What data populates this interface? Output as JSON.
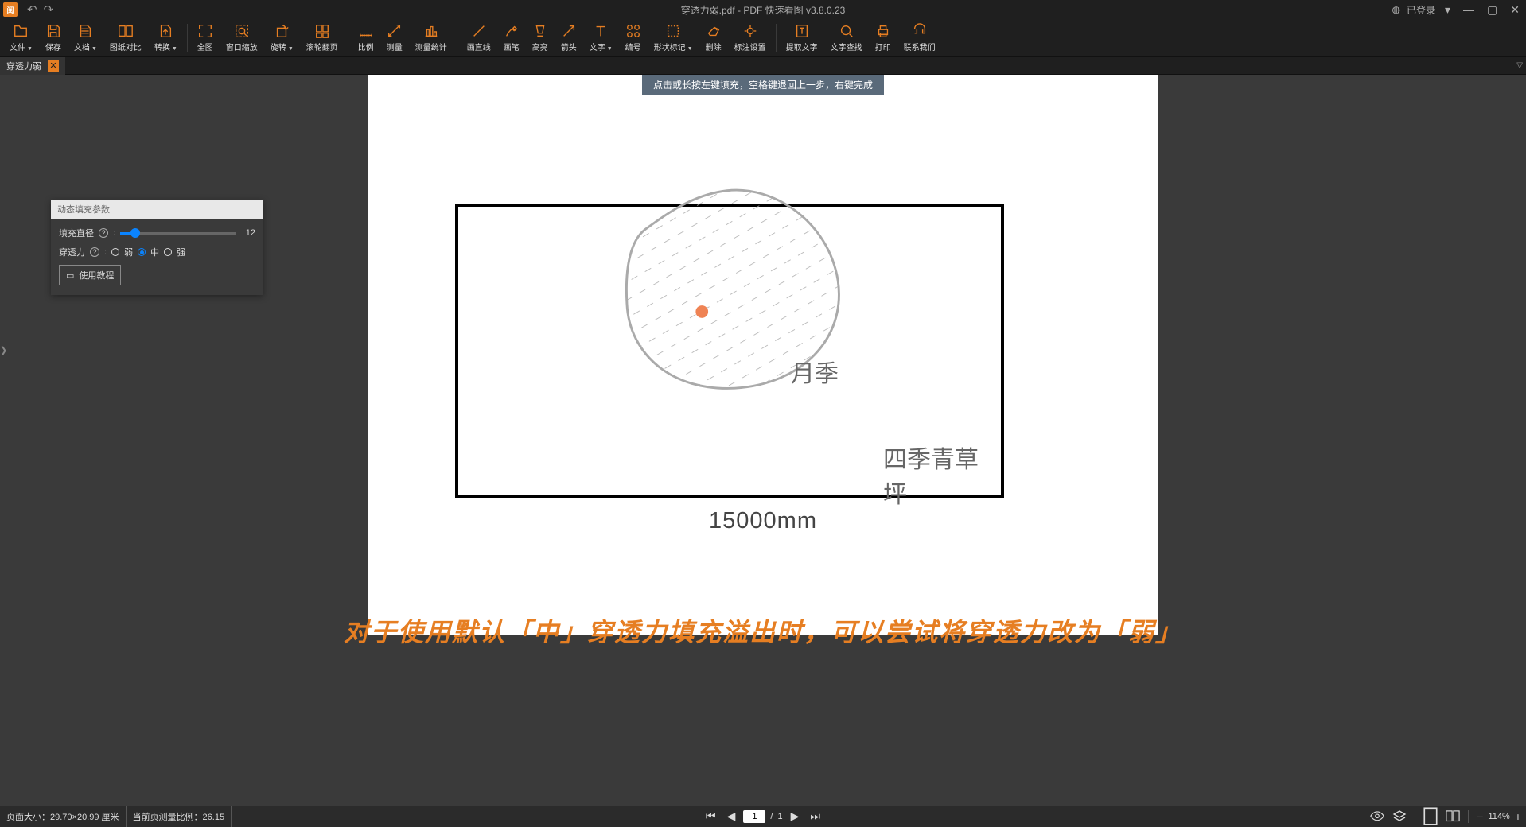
{
  "title": "穿透力弱.pdf - PDF 快速看图 v3.8.0.23",
  "login": "已登录",
  "toolbar": [
    {
      "label": "文件",
      "dd": true
    },
    {
      "label": "保存"
    },
    {
      "label": "文档",
      "dd": true
    },
    {
      "label": "图纸对比"
    },
    {
      "label": "转换",
      "dd": true
    },
    {
      "sep": true
    },
    {
      "label": "全图"
    },
    {
      "label": "窗口缩放"
    },
    {
      "label": "旋转",
      "dd": true
    },
    {
      "label": "滚轮翻页"
    },
    {
      "sep": true
    },
    {
      "label": "比例"
    },
    {
      "label": "测量"
    },
    {
      "label": "测量统计"
    },
    {
      "sep": true
    },
    {
      "label": "画直线"
    },
    {
      "label": "画笔"
    },
    {
      "label": "高亮"
    },
    {
      "label": "箭头"
    },
    {
      "label": "文字",
      "dd": true
    },
    {
      "label": "编号"
    },
    {
      "label": "形状标记",
      "dd": true
    },
    {
      "label": "删除"
    },
    {
      "label": "标注设置"
    },
    {
      "sep": true
    },
    {
      "label": "提取文字"
    },
    {
      "label": "文字查找"
    },
    {
      "label": "打印"
    },
    {
      "label": "联系我们"
    }
  ],
  "tab": {
    "name": "穿透力弱"
  },
  "hint": "点击或长按左键填充，空格键退回上一步，右键完成",
  "drawing": {
    "label1": "月季",
    "label2": "四季青草坪",
    "dim": "15000mm"
  },
  "caption": "对于使用默认「中」穿透力填充溢出时，可以尝试将穿透力改为「弱」",
  "panel": {
    "title": "动态填充参数",
    "diameter_label": "填充直径",
    "diameter_value": "12",
    "penetration_label": "穿透力",
    "opt_weak": "弱",
    "opt_mid": "中",
    "opt_strong": "强",
    "tutorial": "使用教程"
  },
  "status": {
    "page_size": "页面大小：29.70×20.99 厘米",
    "scale": "当前页测量比例：26.15",
    "page": "1",
    "total": "1",
    "zoom": "114%"
  }
}
